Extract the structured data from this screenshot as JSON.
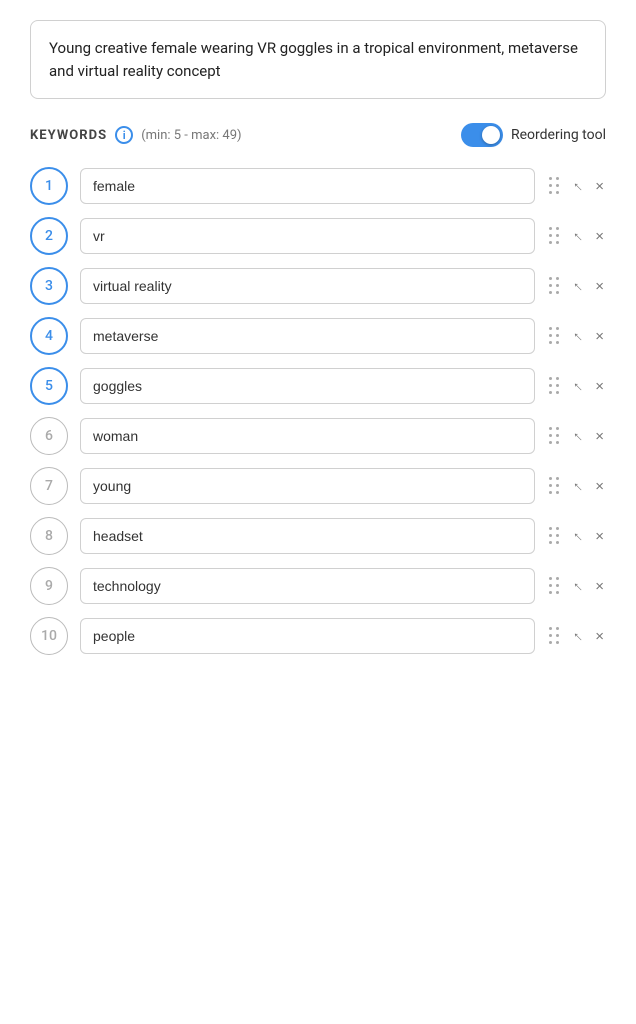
{
  "description": {
    "text": "Young creative female wearing VR goggles in a tropical environment, metaverse and virtual reality concept"
  },
  "keywords_section": {
    "label": "KEYWORDS",
    "info_icon": "i",
    "range_text": "(min: 5 - max: 49)",
    "toggle_label": "Reordering tool",
    "toggle_on": true
  },
  "keywords": [
    {
      "number": 1,
      "value": "female",
      "active": true
    },
    {
      "number": 2,
      "value": "vr",
      "active": true
    },
    {
      "number": 3,
      "value": "virtual reality",
      "active": true
    },
    {
      "number": 4,
      "value": "metaverse",
      "active": true
    },
    {
      "number": 5,
      "value": "goggles",
      "active": true
    },
    {
      "number": 6,
      "value": "woman",
      "active": false
    },
    {
      "number": 7,
      "value": "young",
      "active": false
    },
    {
      "number": 8,
      "value": "headset",
      "active": false
    },
    {
      "number": 9,
      "value": "technology",
      "active": false
    },
    {
      "number": 10,
      "value": "people",
      "active": false
    }
  ],
  "colors": {
    "accent": "#3b8eea",
    "inactive_border": "#bbb",
    "inactive_text": "#aaa"
  }
}
